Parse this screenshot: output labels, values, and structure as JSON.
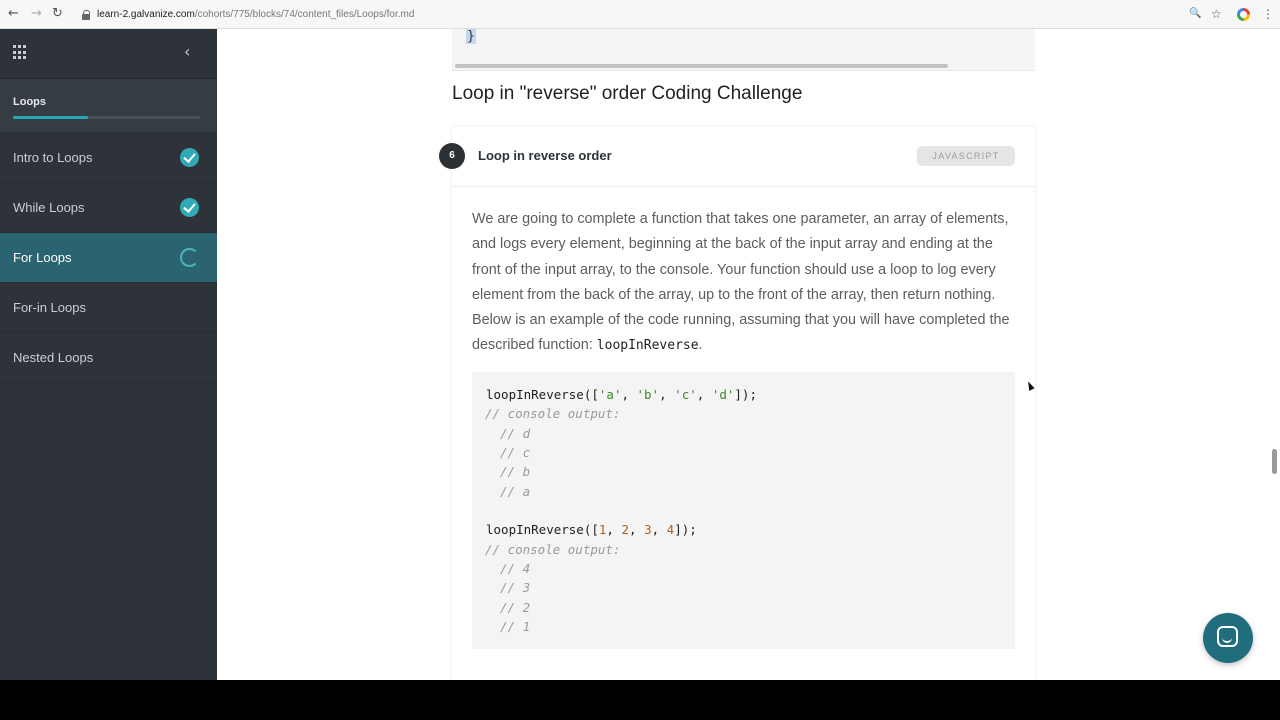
{
  "browser": {
    "url_host": "learn-2.galvanize.com",
    "url_path": "/cohorts/775/blocks/74/content_files/Loops/for.md",
    "back_icon": "←",
    "forward_icon": "→",
    "reload_icon": "↻",
    "zoom_icon": "🔍",
    "star_icon": "☆",
    "menu_icon": "⋮"
  },
  "sidebar": {
    "title": "Loops",
    "progress": 0.4,
    "collapse_icon": "‹",
    "items": [
      {
        "label": "Intro to Loops",
        "status": "complete"
      },
      {
        "label": "While Loops",
        "status": "complete"
      },
      {
        "label": "For Loops",
        "status": "in-progress"
      },
      {
        "label": "For-in Loops",
        "status": "none"
      },
      {
        "label": "Nested Loops",
        "status": "none"
      }
    ]
  },
  "main": {
    "prev_code_line": "}",
    "section_title": "Loop in \"reverse\" order Coding Challenge",
    "challenge": {
      "number": "6",
      "title": "Loop in reverse order",
      "language": "JAVASCRIPT",
      "description": "We are going to complete a function that takes one parameter, an array of elements, and logs every element, beginning at the back of the input array and ending at the front of the input array, to the console. Your function should use a loop to log every element from the back of the array, up to the front of the array, then return nothing. Below is an example of the code running, assuming that you will have completed the described function: ",
      "function_name": "loopInReverse",
      "description_end": ".",
      "code": {
        "call1_fn": "loopInReverse([",
        "call1_args": [
          "'a'",
          "'b'",
          "'c'",
          "'d'"
        ],
        "call1_end": "]);",
        "console_comment": "// console output:",
        "out1": [
          "// d",
          "// c",
          "// b",
          "// a"
        ],
        "call2_fn": "loopInReverse([",
        "call2_args": [
          "1",
          "2",
          "3",
          "4"
        ],
        "call2_end": "]);",
        "out2": [
          "// 4",
          "// 3",
          "// 2",
          "// 1"
        ]
      }
    }
  },
  "colors": {
    "sidebar_bg": "#2d3338",
    "active_item": "#2a6470",
    "accent": "#32a9b6",
    "chat_button": "#1f6d7d"
  }
}
